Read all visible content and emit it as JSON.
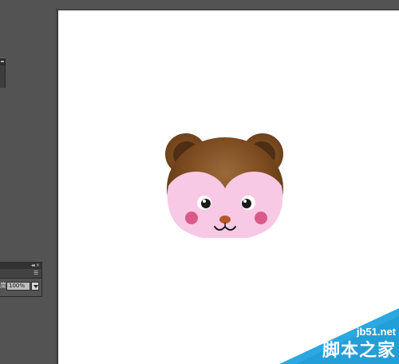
{
  "panels": {
    "transparency": {
      "opacity_label": "度",
      "opacity_value": "100%",
      "collapse_glyph": "◂◂",
      "close_glyph": "×",
      "menu_glyph": "☰"
    }
  },
  "artboard": {
    "artwork": {
      "subject": "monkey-face",
      "colors": {
        "fur": "#7a4a1f",
        "fur_dark": "#4a2a12",
        "ear_inner": "#5a3a1e",
        "face": "#f8c9e4",
        "cheeks": "#d95a8a",
        "nose": "#b4552c",
        "eyes": "#1a1a1a"
      }
    }
  },
  "watermark": {
    "site": "jb51.net",
    "brand": "脚本之家",
    "color": "#2aa8e0"
  }
}
